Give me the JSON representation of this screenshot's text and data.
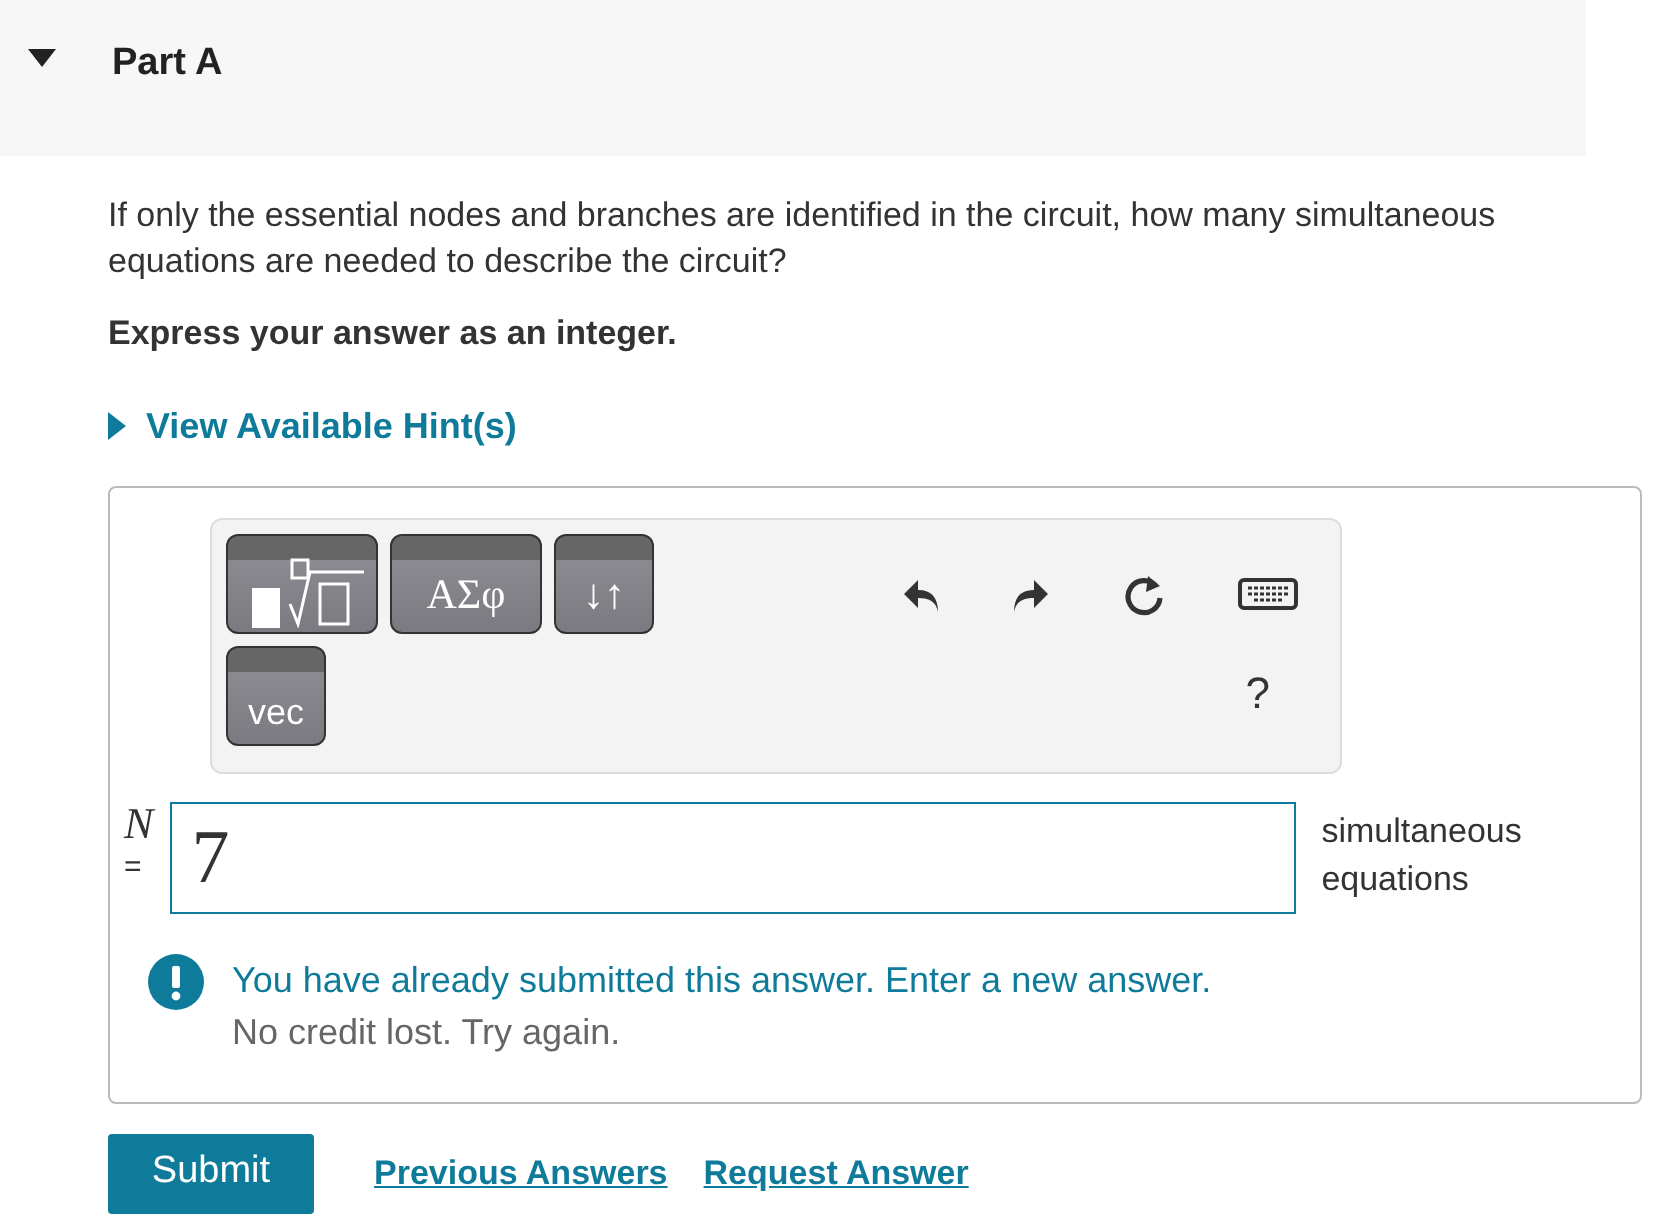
{
  "part": {
    "title": "Part A",
    "expanded": true
  },
  "question": "If only the essential nodes and branches are identified in the circuit, how many simultaneous equations are needed to describe the circuit?",
  "instruction": "Express your answer as an integer.",
  "hint": {
    "label": "View Available Hint(s)",
    "expanded": false
  },
  "toolbar": {
    "buttons": [
      {
        "kind": "templates"
      },
      {
        "kind": "symbols",
        "label": "ΑΣφ"
      },
      {
        "kind": "arrows",
        "label": "↓↑"
      },
      {
        "kind": "vec",
        "label": "vec"
      }
    ],
    "help": "?"
  },
  "answer": {
    "variable": "N",
    "equals": "=",
    "value": "7",
    "units": "simultaneous equations"
  },
  "feedback": {
    "message": "You have already submitted this answer. Enter a new answer.",
    "detail": "No credit lost. Try again."
  },
  "submit": "Submit",
  "links": [
    "Previous Answers",
    "Request Answer"
  ]
}
